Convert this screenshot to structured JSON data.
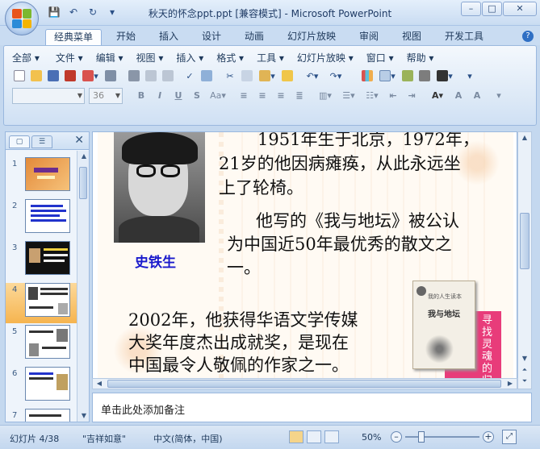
{
  "window": {
    "title": "秋天的怀念ppt.ppt [兼容模式] - Microsoft PowerPoint"
  },
  "qat": {
    "save": "💾",
    "undo": "↶",
    "redo": "↻",
    "more": "▾"
  },
  "tabs": [
    "经典菜单",
    "开始",
    "插入",
    "设计",
    "动画",
    "幻灯片放映",
    "审阅",
    "视图",
    "开发工具"
  ],
  "menus": [
    "全部 ▾",
    "文件 ▾",
    "编辑 ▾",
    "视图 ▾",
    "插入 ▾",
    "格式 ▾",
    "工具 ▾",
    "幻灯片放映 ▾",
    "窗口 ▾",
    "帮助 ▾"
  ],
  "format": {
    "font_name": "",
    "font_size": "36"
  },
  "slides_panel": {
    "numbers": [
      "1",
      "2",
      "3",
      "4",
      "5",
      "6",
      "7"
    ],
    "selected": 4
  },
  "slide": {
    "line1": "1951年生于北京，1972年，",
    "line2": "21岁的他因病瘫痪，从此永远坐",
    "line3": "上了轮椅。",
    "para2_line1": "他写的《我与地坛》被公认",
    "para2_line2": "为中国近50年最优秀的散文之",
    "para2_line3": "一。",
    "author_name": "史铁生",
    "para3_line1": "2002年，他获得华语文学传媒",
    "para3_line2": "大奖年度杰出成就奖，是现在",
    "para3_line3": "中国最令人敬佩的作家之一。",
    "book_title": "我与地坛",
    "book_series": "我的人生读本",
    "book2_text": "寻找灵魂的归宿"
  },
  "notes": {
    "placeholder": "单击此处添加备注"
  },
  "status": {
    "slide_info": "幻灯片 4/38",
    "theme": "\"吉祥如意\"",
    "language": "中文(简体，中国)",
    "zoom": "50%"
  },
  "colors": {
    "accent_selected": "#f6b44f",
    "author_blue": "#1a1acc"
  }
}
